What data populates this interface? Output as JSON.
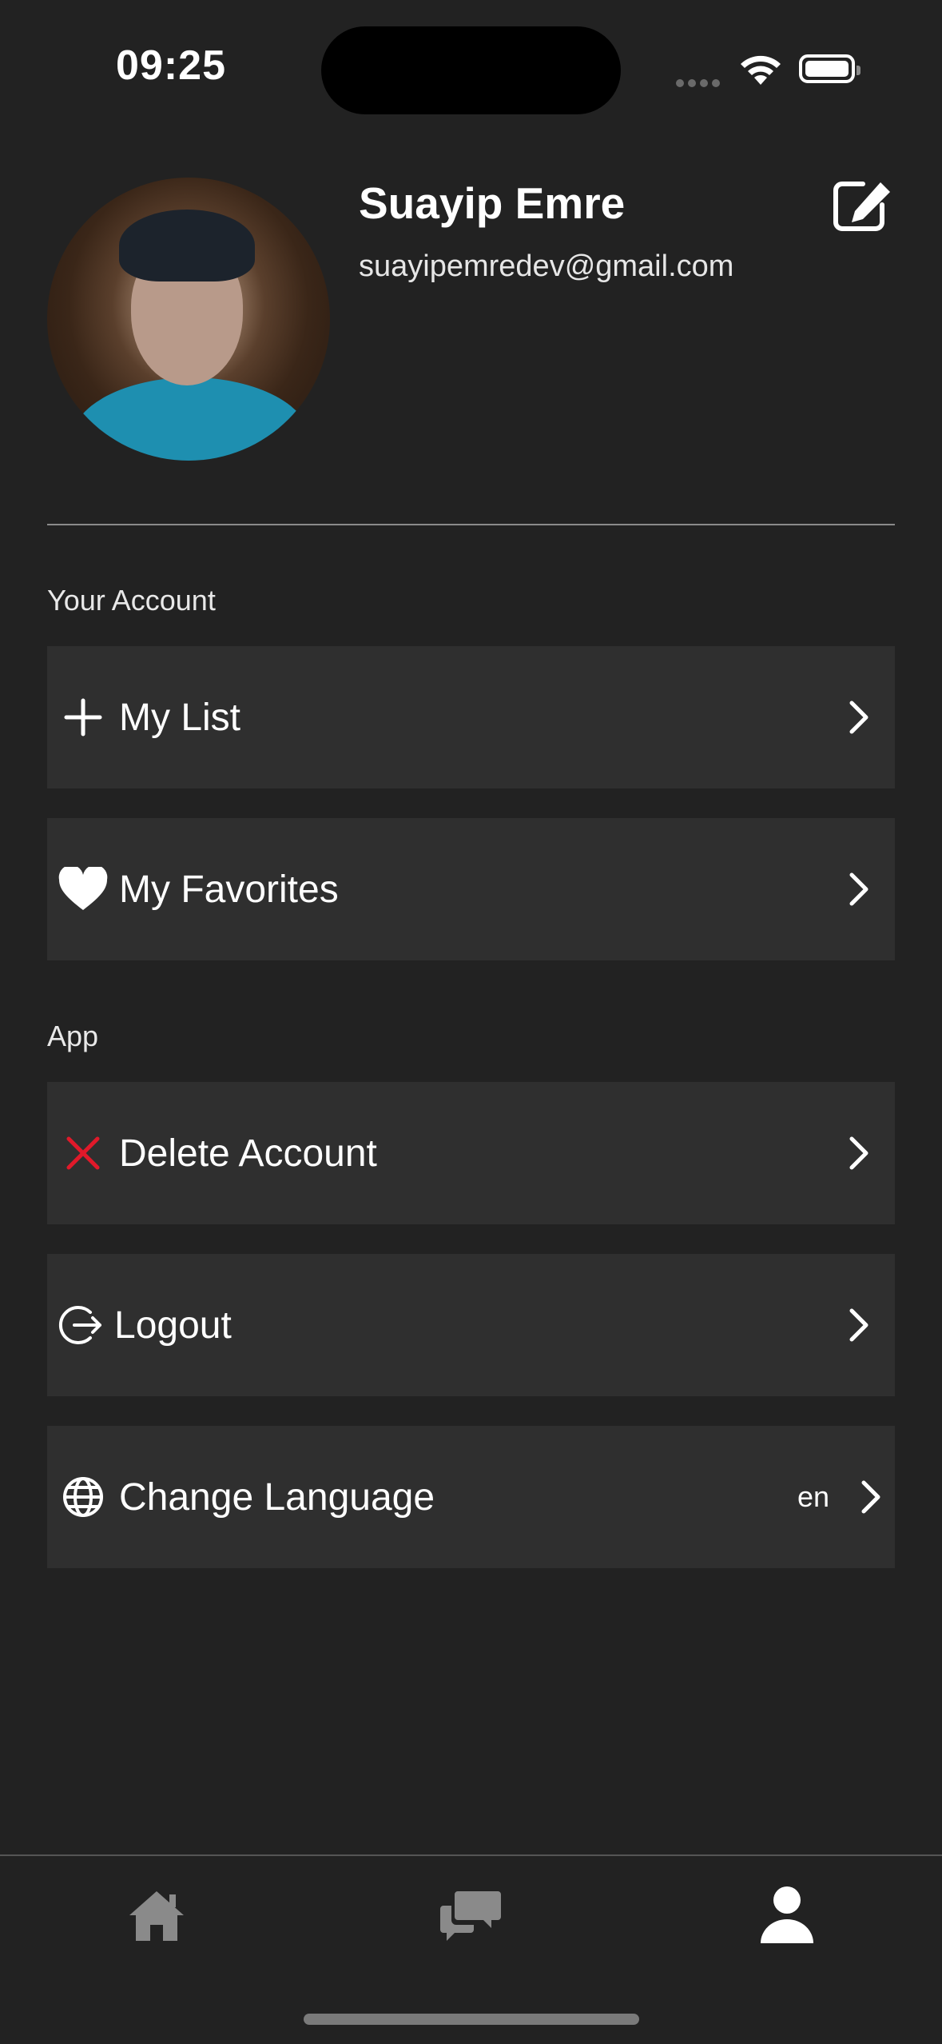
{
  "status_bar": {
    "time": "09:25",
    "icons": [
      "signal-dots-icon",
      "wifi-icon",
      "battery-icon"
    ]
  },
  "profile": {
    "name": "Suayip Emre",
    "email": "suayipemredev@gmail.com",
    "edit_icon": "edit-icon"
  },
  "sections": {
    "account_label": "Your Account",
    "app_label": "App"
  },
  "menu": {
    "my_list": {
      "label": "My List",
      "icon": "plus-icon"
    },
    "my_favorites": {
      "label": "My Favorites",
      "icon": "heart-icon"
    },
    "delete_account": {
      "label": "Delete Account",
      "icon": "close-icon",
      "icon_color": "#e0192a"
    },
    "logout": {
      "label": "Logout",
      "icon": "logout-icon"
    },
    "change_language": {
      "label": "Change Language",
      "icon": "globe-icon",
      "value": "en"
    }
  },
  "tab_bar": {
    "tabs": [
      {
        "name": "home",
        "icon": "home-icon",
        "active": false
      },
      {
        "name": "chat",
        "icon": "chat-icon",
        "active": false
      },
      {
        "name": "profile",
        "icon": "user-icon",
        "active": true
      }
    ]
  },
  "colors": {
    "background": "#222222",
    "row_background": "#2f2f2f",
    "inactive_tab": "#8a8a8a",
    "active_tab": "#ffffff",
    "danger": "#e0192a"
  }
}
